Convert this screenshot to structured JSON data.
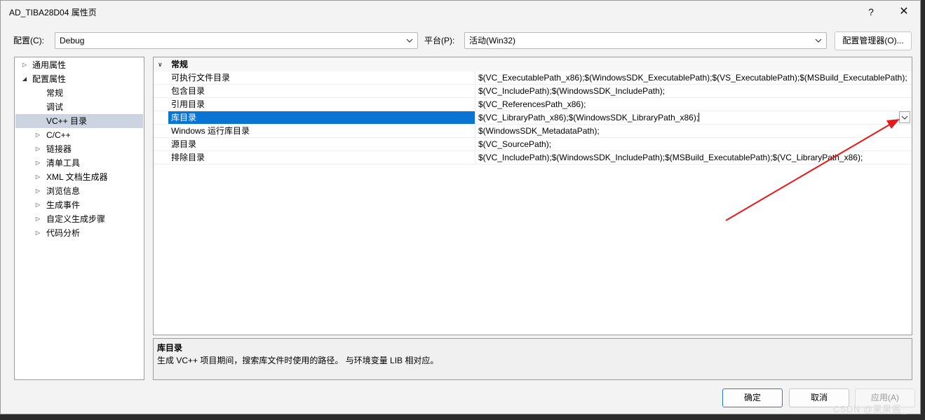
{
  "window": {
    "title": "AD_TIBA28D04 属性页",
    "help_glyph": "?",
    "close_glyph": "✕"
  },
  "toolbar": {
    "config_label": "配置(C):",
    "config_value": "Debug",
    "platform_label": "平台(P):",
    "platform_value": "活动(Win32)",
    "config_manager_label": "配置管理器(O)..."
  },
  "tree": {
    "items": [
      {
        "label": "通用属性",
        "toggle": "▷"
      },
      {
        "label": "配置属性",
        "toggle": "◢"
      },
      {
        "label": "常规",
        "toggle": ""
      },
      {
        "label": "调试",
        "toggle": ""
      },
      {
        "label": "VC++ 目录",
        "toggle": ""
      },
      {
        "label": "C/C++",
        "toggle": "▷"
      },
      {
        "label": "链接器",
        "toggle": "▷"
      },
      {
        "label": "清单工具",
        "toggle": "▷"
      },
      {
        "label": "XML 文档生成器",
        "toggle": "▷"
      },
      {
        "label": "浏览信息",
        "toggle": "▷"
      },
      {
        "label": "生成事件",
        "toggle": "▷"
      },
      {
        "label": "自定义生成步骤",
        "toggle": "▷"
      },
      {
        "label": "代码分析",
        "toggle": "▷"
      }
    ]
  },
  "grid": {
    "category": "常规",
    "category_toggle": "∨",
    "rows": [
      {
        "name": "可执行文件目录",
        "value": "$(VC_ExecutablePath_x86);$(WindowsSDK_ExecutablePath);$(VS_ExecutablePath);$(MSBuild_ExecutablePath);"
      },
      {
        "name": "包含目录",
        "value": "$(VC_IncludePath);$(WindowsSDK_IncludePath);"
      },
      {
        "name": "引用目录",
        "value": "$(VC_ReferencesPath_x86);"
      },
      {
        "name": "库目录",
        "value": "$(VC_LibraryPath_x86);$(WindowsSDK_LibraryPath_x86);"
      },
      {
        "name": "Windows 运行库目录",
        "value": "$(WindowsSDK_MetadataPath);"
      },
      {
        "name": "源目录",
        "value": "$(VC_SourcePath);"
      },
      {
        "name": "排除目录",
        "value": "$(VC_IncludePath);$(WindowsSDK_IncludePath);$(MSBuild_ExecutablePath);$(VC_LibraryPath_x86);"
      }
    ]
  },
  "description": {
    "title": "库目录",
    "text": "生成 VC++ 项目期间，搜索库文件时使用的路径。 与环境变量 LIB 相对应。"
  },
  "footer": {
    "ok_label": "确定",
    "cancel_label": "取消",
    "apply_label": "应用(A)"
  },
  "watermark": "CSDN @果果酱_",
  "colors": {
    "selection": "#0a74d5",
    "tree_selection": "#ccd4e2",
    "annotation_arrow": "#e8191b"
  }
}
